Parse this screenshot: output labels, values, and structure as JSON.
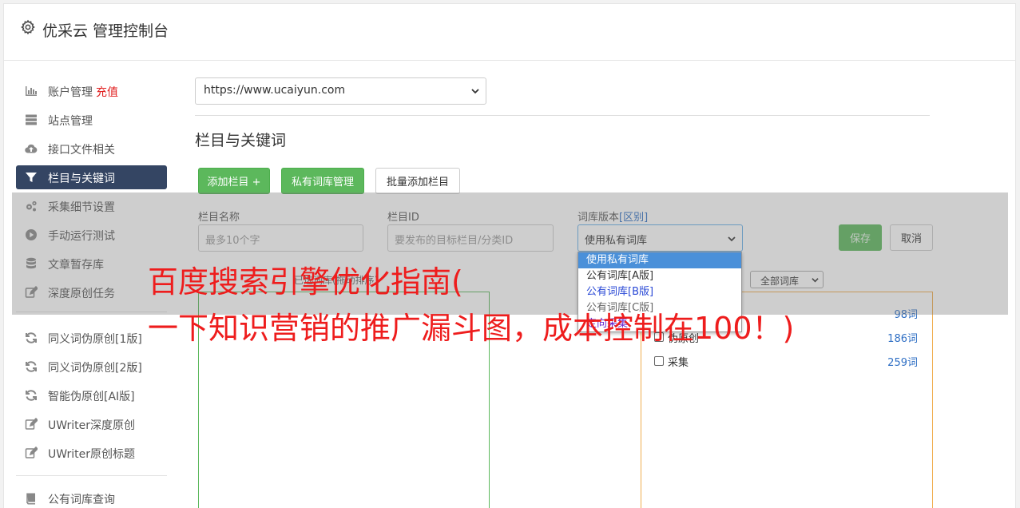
{
  "header": {
    "title": "优采云 管理控制台"
  },
  "sidebar": {
    "items": [
      {
        "label": "账户管理",
        "extra": "充值",
        "icon": "bar-chart-icon"
      },
      {
        "label": "站点管理",
        "icon": "server-icon"
      },
      {
        "label": "接口文件相关",
        "icon": "cloud-upload-icon"
      },
      {
        "label": "栏目与关键词",
        "icon": "filter-icon",
        "active": true
      },
      {
        "label": "采集细节设置",
        "icon": "gears-icon"
      },
      {
        "label": "手动运行测试",
        "icon": "play-circle-icon"
      },
      {
        "label": "文章暂存库",
        "icon": "database-icon"
      },
      {
        "label": "深度原创任务",
        "icon": "edit-icon"
      },
      {
        "label": "同义词伪原创[1版]",
        "icon": "refresh-icon"
      },
      {
        "label": "同义词伪原创[2版]",
        "icon": "refresh-icon"
      },
      {
        "label": "智能伪原创[AI版]",
        "icon": "refresh-icon"
      },
      {
        "label": "UWriter深度原创",
        "icon": "edit-icon"
      },
      {
        "label": "UWriter原创标题",
        "icon": "edit-icon"
      },
      {
        "label": "公有词库查询",
        "icon": "book-icon"
      }
    ]
  },
  "main": {
    "site_select": "https://www.ucaiyun.com",
    "section_title": "栏目与关键词",
    "buttons": {
      "add_column": "添加栏目 +",
      "private_lib": "私有词库管理",
      "batch_add": "批量添加栏目",
      "save": "保存",
      "cancel": "取消"
    },
    "form": {
      "name_label": "栏目名称",
      "name_placeholder": "最多10个字",
      "id_label": "栏目ID",
      "id_placeholder": "要发布的目标栏目/分类ID",
      "lib_label": "词库版本",
      "lib_label_link": "[区别]",
      "lib_value": "使用私有词库"
    },
    "left_panel_hint": "已选词库(拖动排序)",
    "library_filter": "全部词库",
    "libraries": [
      {
        "name": "",
        "count": "98词"
      },
      {
        "name": "伪原创",
        "count": "186词"
      },
      {
        "name": "采集",
        "count": "259词"
      }
    ],
    "dropdown_options": [
      {
        "label": "使用私有词库",
        "state": "selected"
      },
      {
        "label": "公有词库[A版]",
        "state": "normal"
      },
      {
        "label": "公有词库[B版]",
        "state": "blue"
      },
      {
        "label": "公有词库[C版]",
        "state": "grey"
      },
      {
        "label": "定向采集",
        "state": "purple"
      }
    ]
  },
  "watermark": {
    "line1": "百度搜索引擎优化指南(",
    "line2": "一下知识营销的推广漏斗图，成本控制在100！)"
  },
  "colors": {
    "nav_active": "#344563",
    "green": "#5cb85c",
    "link_blue": "#2f6fc4",
    "charge_red": "#e01b1b",
    "watermark_red": "#ee1d1d"
  }
}
